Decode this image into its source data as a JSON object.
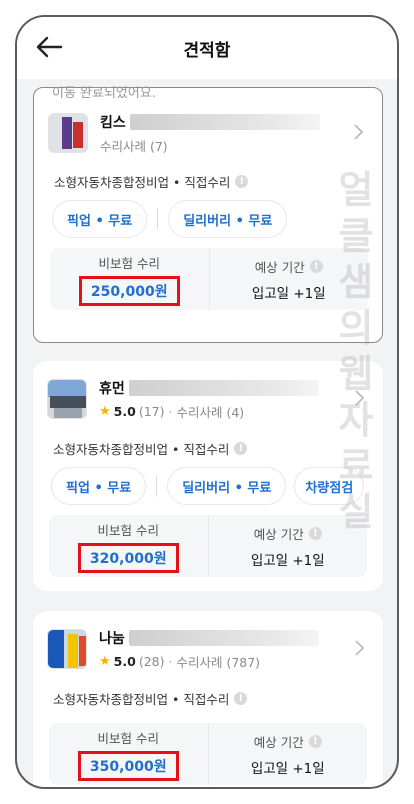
{
  "header": {
    "title": "견적함"
  },
  "top_partial_text": "이동 완료되었어요.",
  "watermark": "얼클샘의웹자료실",
  "cards": [
    {
      "name_prefix": "킴스",
      "meta": "수리사례 (7)",
      "category": "소형자동차종합정비업 • 직접수리",
      "chips": [
        "픽업 • 무료",
        "딜리버리 • 무료"
      ],
      "price_label": "비보험 수리",
      "price": "250,000원",
      "period_label": "예상 기간",
      "period": "입고일 +1일"
    },
    {
      "name_prefix": "휴먼",
      "rating": "5.0",
      "reviews": "(17)",
      "meta": "수리사례 (4)",
      "category": "소형자동차종합정비업 • 직접수리",
      "chips": [
        "픽업 • 무료",
        "딜리버리 • 무료",
        "차량점검"
      ],
      "price_label": "비보험 수리",
      "price": "320,000원",
      "period_label": "예상 기간",
      "period": "입고일 +1일"
    },
    {
      "name_prefix": "나눔",
      "rating": "5.0",
      "reviews": "(28)",
      "meta": "수리사례 (787)",
      "category": "소형자동차종합정비업 • 직접수리",
      "price_label": "비보험 수리",
      "price": "350,000원",
      "period_label": "예상 기간",
      "period": "입고일 +1일"
    }
  ],
  "colors": {
    "accent": "#1f6fd1",
    "highlight_box": "#e4101a",
    "background": "#f2f3f5"
  },
  "icons": [
    "back-arrow-icon",
    "chevron-right-icon",
    "star-icon",
    "info-icon"
  ]
}
